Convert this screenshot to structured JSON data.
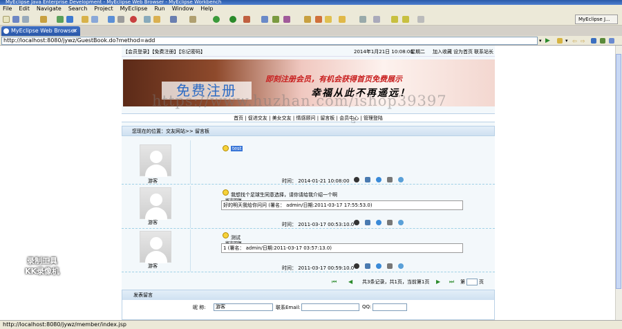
{
  "window": {
    "title": "MyEclipse Java Enterprise Development - MyEclipse Web Browser - MyEclipse Workbench"
  },
  "menu": [
    "File",
    "Edit",
    "Navigate",
    "Search",
    "Project",
    "MyEclipse",
    "Run",
    "Window",
    "Help"
  ],
  "perspective": "MyEclipse J...",
  "tab": {
    "label": "MyEclipse Web Browser"
  },
  "address": {
    "url": "http://localhost:8080/jywz/GuestBook.do?method=add"
  },
  "page": {
    "top_links": "【会员登录】【免费注册】【忘记密码】",
    "date": "2014年1月21日 10:08:00",
    "weekday": "星期二",
    "fav": "加入收藏",
    "home": "设为首页",
    "contact": "联系站长",
    "banner": {
      "register": "免费注册",
      "slogan1": "即刻注册会员，有机会获得首页免费展示",
      "slogan2": "幸福从此不再遥远！"
    },
    "watermark": "https://www.huzhan.com/ishop39397",
    "nav": [
      "首页",
      "促进交友",
      "美女交友",
      "情感顾问",
      "留言板",
      "会员中心",
      "管理登陆"
    ],
    "breadcrumb": "您现在的位置：交友网站>> 留言板",
    "messages": [
      {
        "user": "游客",
        "text": "test",
        "time": "时间： 2014-01-21 10:08:00",
        "reply_title": "",
        "reply": ""
      },
      {
        "user": "游客",
        "text": "我想找个足球生同意选择，请你请给我介绍一个啊",
        "time": "时间： 2011-03-17 00:53:10.0",
        "reply_title": "留言回复",
        "reply": "好的明天我给你问问  (署名： admin/日期:2011-03-17 17:55:53.0)"
      },
      {
        "user": "游客",
        "text": "测试",
        "time": "时间： 2011-03-17 00:59:10.0",
        "reply_title": "留言回复",
        "reply": "1  (署名： admin/日期:2011-03-17 03:57:13.0)"
      }
    ],
    "pager": "共3条记录，共1页，当前第1页",
    "pager_go": "第",
    "pager_page": "页",
    "form": {
      "header": "发表留言",
      "name_label": "昵    称:",
      "name_value": "游客",
      "email_label": "联系Email:",
      "qq_label": "QQ:"
    }
  },
  "status": "http://localhost:8080/jywz/member/index.jsp",
  "overlay": {
    "line1": "录制工具",
    "line2": "KK录像机"
  }
}
